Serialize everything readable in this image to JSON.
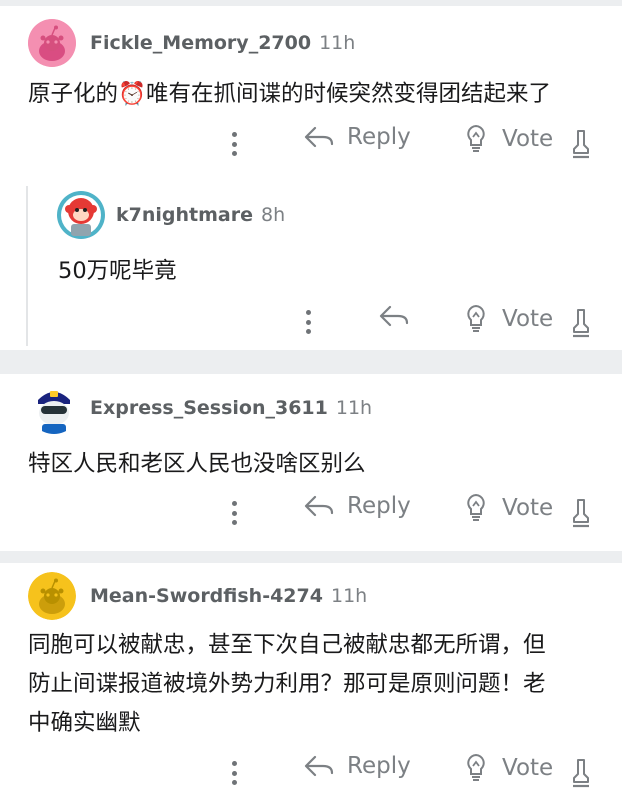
{
  "comments": [
    {
      "username": "Fickle_Memory_2700",
      "age": "11h",
      "text": "原子化的⏰唯有在抓间谍的时候突然变得团结起来了",
      "reply_label": "Reply",
      "vote_label": "Vote",
      "avatar_color": "#f48fb1",
      "reply": {
        "username": "k7nightmare",
        "age": "8h",
        "text": "50万呢毕竟",
        "vote_label": "Vote",
        "avatar_color": "#ef5350"
      }
    },
    {
      "username": "Express_Session_3611",
      "age": "11h",
      "text": "特区人民和老区人民也没啥区别么",
      "reply_label": "Reply",
      "vote_label": "Vote",
      "avatar_color": "#1565c0"
    },
    {
      "username": "Mean-Swordfish-4274",
      "age": "11h",
      "text_lines": [
        "同胞可以被献忠，甚至下次自己被献忠都无所谓，但",
        "防止间谍报道被境外势力利用？那可是原则问题！老",
        "中确实幽默"
      ],
      "reply_label": "Reply",
      "vote_label": "Vote",
      "avatar_color": "#f6c21c"
    }
  ]
}
